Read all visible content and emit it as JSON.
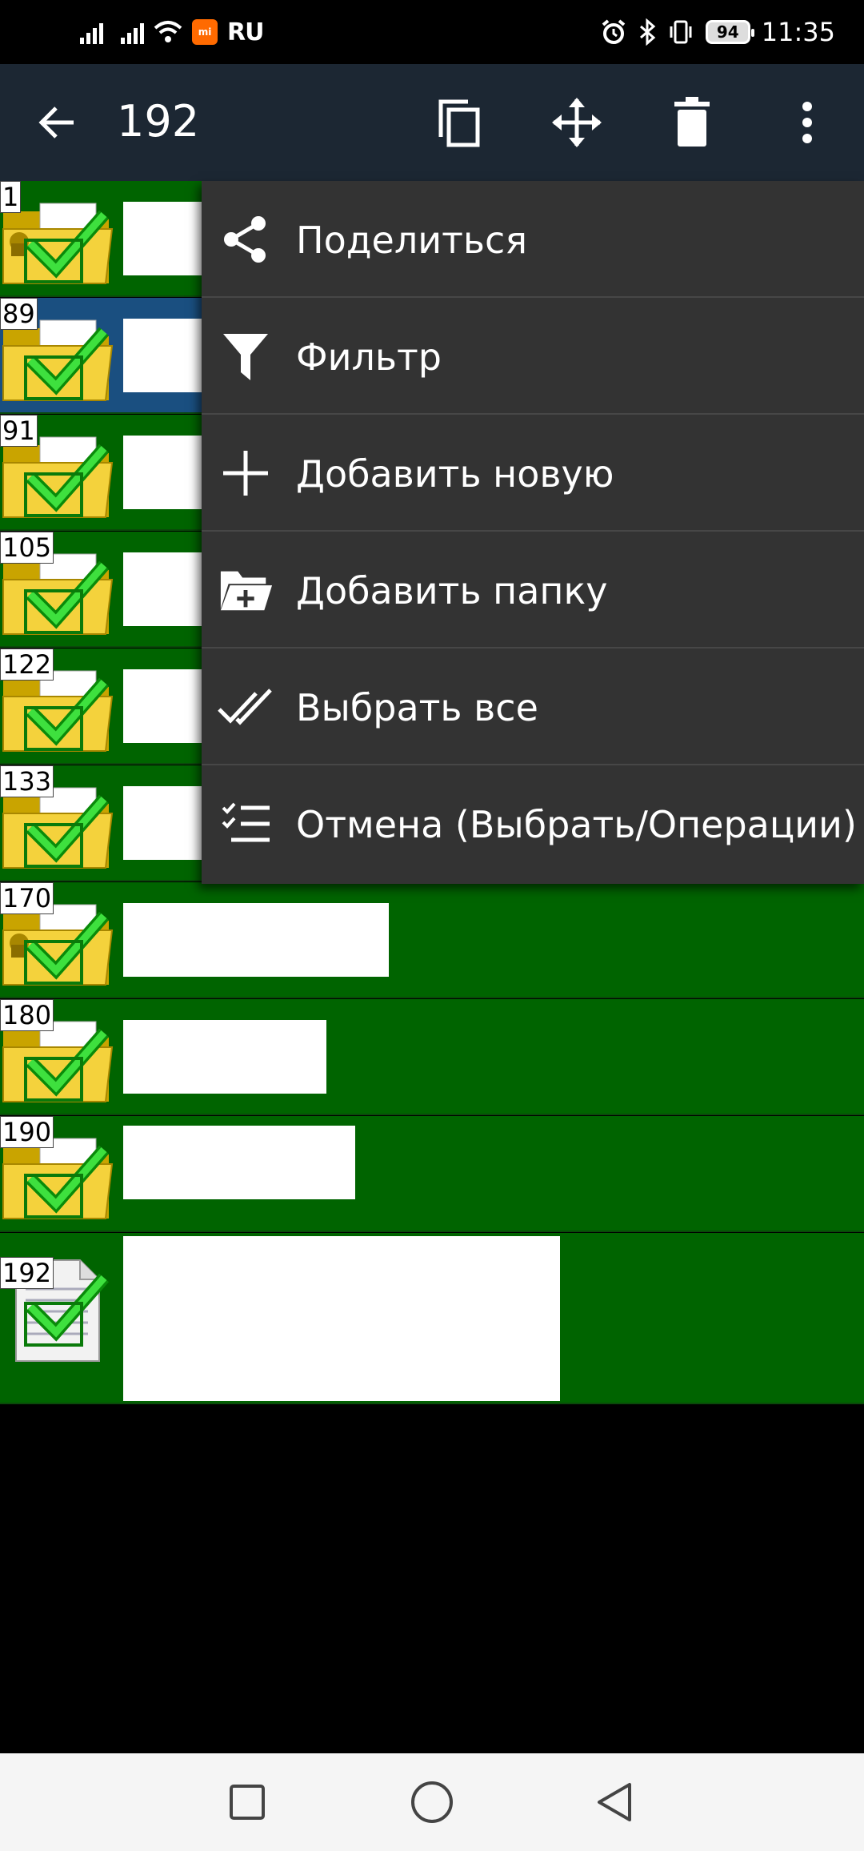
{
  "status_bar": {
    "left_indicator": "RU",
    "battery": "94",
    "time": "11:35"
  },
  "toolbar": {
    "back_icon": "arrow-left-icon",
    "title": "192",
    "actions": [
      "copy-icon",
      "move-icon",
      "trash-icon",
      "more-vert-icon"
    ]
  },
  "list": {
    "items": [
      {
        "number": "1",
        "icon": "folder-lock-icon",
        "checked": true
      },
      {
        "number": "89",
        "icon": "folder-icon",
        "checked": true
      },
      {
        "number": "91",
        "icon": "folder-icon",
        "checked": true
      },
      {
        "number": "105",
        "icon": "folder-icon",
        "checked": true
      },
      {
        "number": "122",
        "icon": "folder-icon",
        "checked": true
      },
      {
        "number": "133",
        "icon": "folder-icon",
        "checked": true
      },
      {
        "number": "170",
        "icon": "folder-lock-icon",
        "checked": true
      },
      {
        "number": "180",
        "icon": "folder-icon",
        "checked": true
      },
      {
        "number": "190",
        "icon": "folder-icon",
        "checked": true
      },
      {
        "number": "192",
        "icon": "document-icon",
        "checked": true
      }
    ]
  },
  "menu": {
    "items": [
      {
        "label": "Поделиться",
        "icon": "share-icon"
      },
      {
        "label": "Фильтр",
        "icon": "filter-icon"
      },
      {
        "label": "Добавить новую",
        "icon": "plus-icon"
      },
      {
        "label": "Добавить папку",
        "icon": "folder-add-icon"
      },
      {
        "label": "Выбрать все",
        "icon": "double-check-icon"
      },
      {
        "label": "Отмена (Выбрать/Операции)",
        "icon": "checklist-icon"
      }
    ]
  },
  "nav_bar": {
    "buttons": [
      "recents-square-icon",
      "home-circle-icon",
      "back-triangle-icon"
    ]
  },
  "colors": {
    "row_bg": "#006400",
    "row_selected_bg": "#1a4f80",
    "toolbar_bg": "#1c2733",
    "menu_bg": "#333333"
  }
}
